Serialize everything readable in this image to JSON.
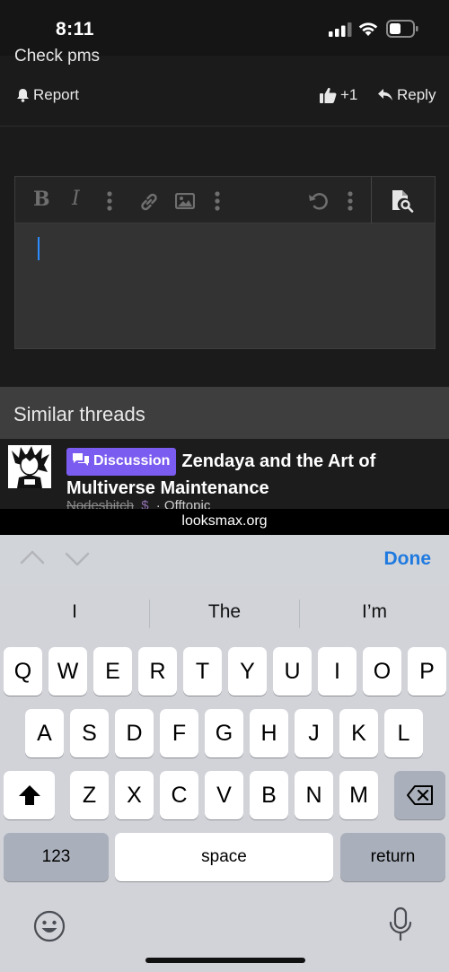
{
  "status": {
    "time": "8:11"
  },
  "post": {
    "text": "Check pms",
    "report_label": "Report",
    "like_count": "+1",
    "reply_label": "Reply"
  },
  "similar": {
    "header": "Similar threads",
    "thread": {
      "badge": "Discussion",
      "title": "Zendaya and the Art of Multiverse Maintenance",
      "author": "Nodesbitch",
      "forum": "Offtopic"
    }
  },
  "browser": {
    "url": "looksmax.org"
  },
  "keyboard": {
    "done_label": "Done",
    "suggestions": [
      "I",
      "The",
      "I’m"
    ],
    "row1": [
      "Q",
      "W",
      "E",
      "R",
      "T",
      "Y",
      "U",
      "I",
      "O",
      "P"
    ],
    "row2": [
      "A",
      "S",
      "D",
      "F",
      "G",
      "H",
      "J",
      "K",
      "L"
    ],
    "row3": [
      "Z",
      "X",
      "C",
      "V",
      "B",
      "N",
      "M"
    ],
    "numbers_label": "123",
    "space_label": "space",
    "return_label": "return"
  }
}
